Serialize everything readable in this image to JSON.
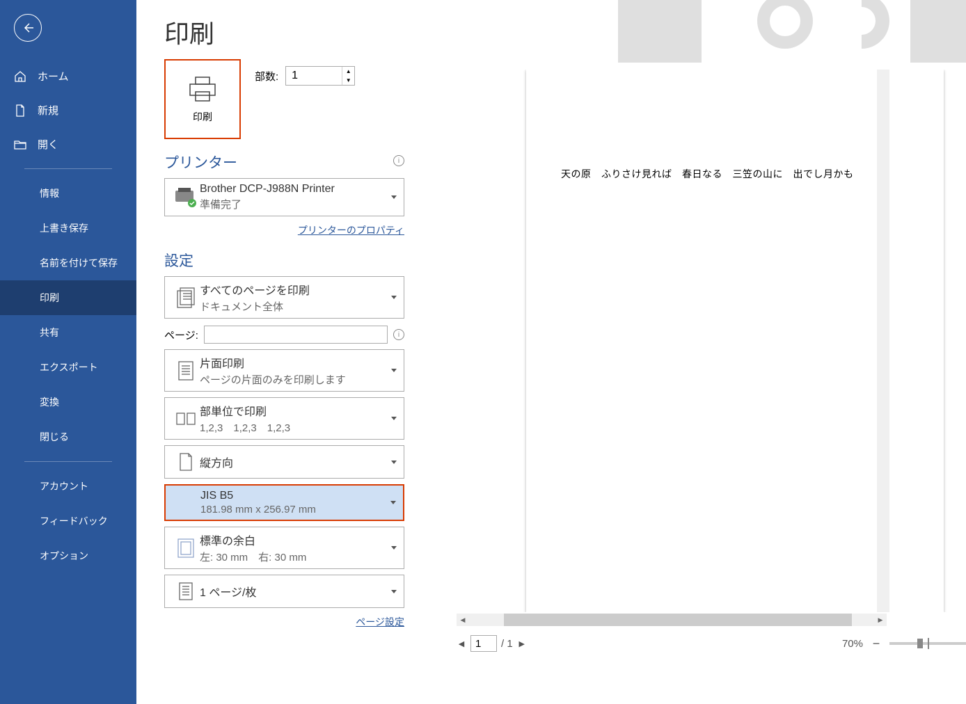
{
  "title": "印刷",
  "nav": {
    "home": "ホーム",
    "new": "新規",
    "open": "開く",
    "info": "情報",
    "save": "上書き保存",
    "saveas": "名前を付けて保存",
    "print": "印刷",
    "share": "共有",
    "export": "エクスポート",
    "transform": "変換",
    "close": "閉じる",
    "account": "アカウント",
    "feedback": "フィードバック",
    "options": "オプション"
  },
  "print": {
    "button_label": "印刷",
    "copies_label": "部数:",
    "copies_value": "1"
  },
  "printer": {
    "header": "プリンター",
    "name": "Brother DCP-J988N Printer",
    "status": "準備完了",
    "properties_link": "プリンターのプロパティ"
  },
  "settings": {
    "header": "設定",
    "print_all_title": "すべてのページを印刷",
    "print_all_sub": "ドキュメント全体",
    "pages_label": "ページ:",
    "oneside_title": "片面印刷",
    "oneside_sub": "ページの片面のみを印刷します",
    "collate_title": "部単位で印刷",
    "collate_sub": "1,2,3　1,2,3　1,2,3",
    "orientation": "縦方向",
    "paper_title": "JIS B5",
    "paper_sub": "181.98 mm x 256.97 mm",
    "margin_title": "標準の余白",
    "margin_sub": "左: 30 mm　右: 30 mm",
    "per_sheet": "1 ページ/枚",
    "page_setup_link": "ページ設定"
  },
  "preview": {
    "content": "天の原　ふりさけ見れば　春日なる　三笠の山に　出でし月かも"
  },
  "footer": {
    "page_current": "1",
    "page_total": "/ 1",
    "zoom": "70%"
  }
}
